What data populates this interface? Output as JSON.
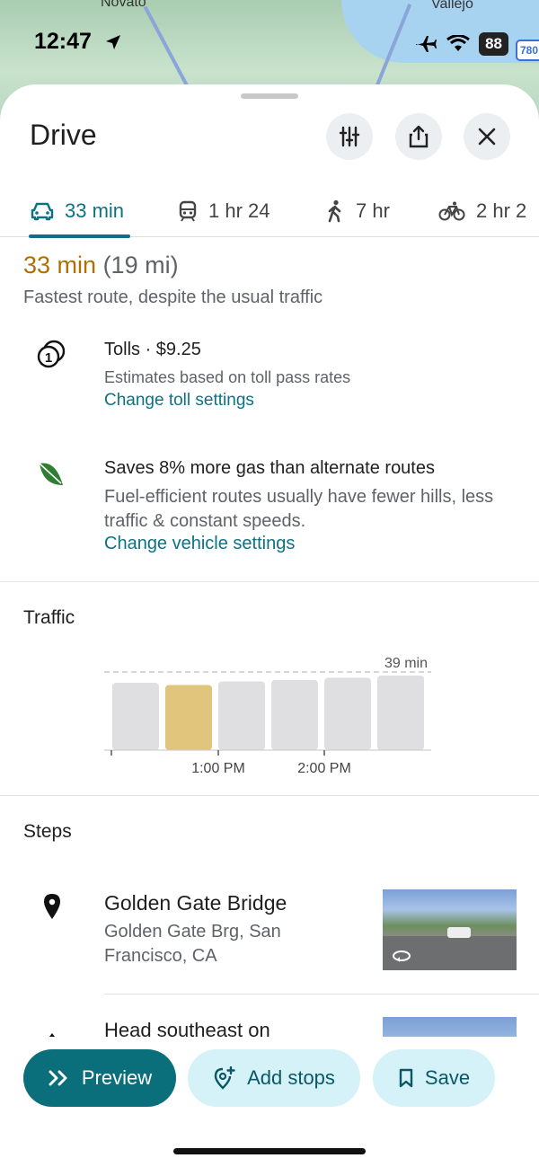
{
  "map": {
    "labels": [
      "Novato",
      "Vallejo"
    ],
    "shield": "780"
  },
  "status_bar": {
    "time": "12:47",
    "battery": "88"
  },
  "header": {
    "title": "Drive"
  },
  "modes": [
    {
      "label": "33 min",
      "icon": "car-icon",
      "active": true
    },
    {
      "label": "1 hr 24",
      "icon": "train-icon",
      "active": false
    },
    {
      "label": "7 hr",
      "icon": "walk-icon",
      "active": false
    },
    {
      "label": "2 hr 2",
      "icon": "bike-icon",
      "active": false
    }
  ],
  "summary": {
    "duration": "33 min",
    "distance": "(19 mi)",
    "note": "Fastest route, despite the usual traffic"
  },
  "tolls": {
    "title": "Tolls · $9.25",
    "subtitle": "Estimates based on toll pass rates",
    "link": "Change toll settings"
  },
  "eco": {
    "title": "Saves 8% more gas than alternate routes",
    "desc": "Fuel-efficient routes usually have fewer hills, less traffic & constant speeds.",
    "link": "Change vehicle settings"
  },
  "traffic": {
    "heading": "Traffic",
    "max_label": "39 min",
    "ticks": [
      "1:00 PM",
      "2:00 PM"
    ],
    "bars": [
      0.93,
      0.9,
      0.95,
      0.97,
      1.0,
      1.03
    ],
    "highlight_index": 1,
    "colors": {
      "bar": "#dfdfe2",
      "highlight": "#e2c57c"
    }
  },
  "steps": {
    "heading": "Steps",
    "items": [
      {
        "title": "Golden Gate Bridge",
        "address": "Golden Gate Brg, San Francisco, CA"
      },
      {
        "title": "Head southeast on"
      }
    ]
  },
  "actions": {
    "preview": "Preview",
    "add_stops": "Add stops",
    "save": "Save"
  },
  "colors": {
    "accent": "#0b7285",
    "duration": "#b06f00",
    "eco_leaf": "#2e7d32"
  }
}
